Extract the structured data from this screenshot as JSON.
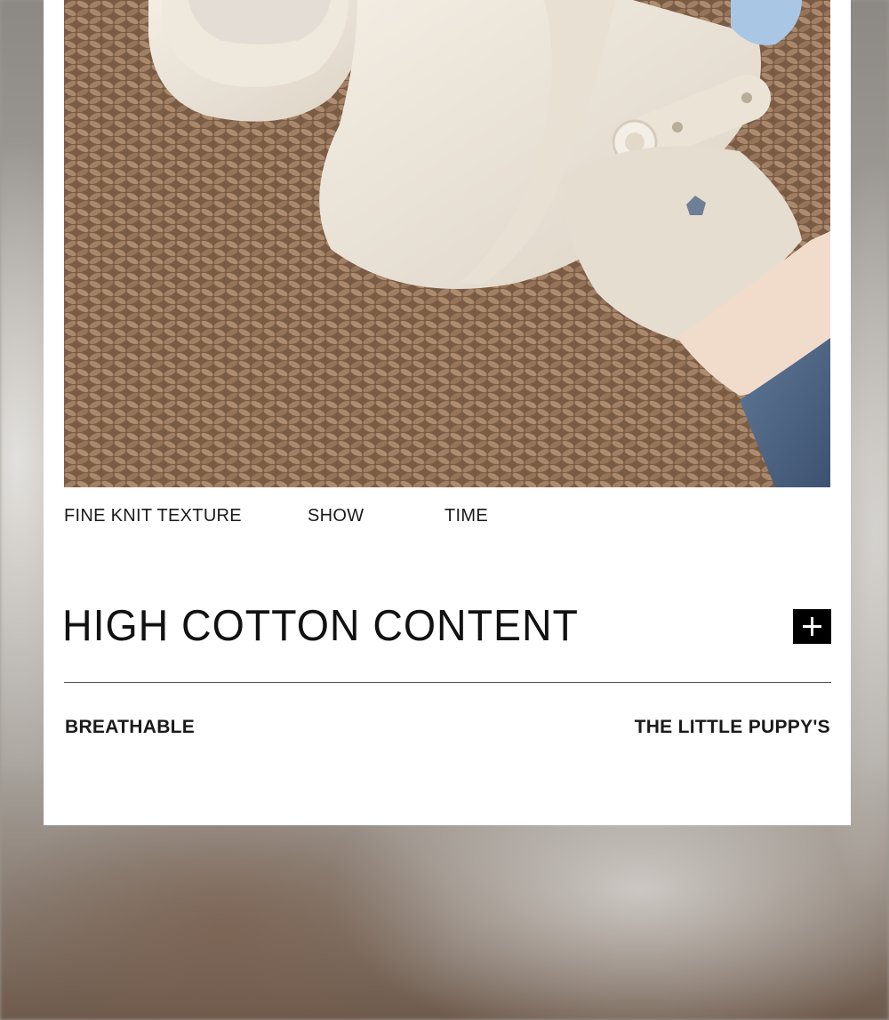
{
  "photo": {
    "icon": "product-photo-feet-clogs-socks"
  },
  "captions": [
    "FINE KNIT TEXTURE",
    "SHOW",
    "TIME"
  ],
  "headline": "HIGH COTTON CONTENT",
  "expand_button": {
    "icon": "plus-icon"
  },
  "features": {
    "left": "BREATHABLE",
    "right": "THE LITTLE PUPPY'S"
  },
  "colors": {
    "card": "#ffffff",
    "text": "#111111",
    "button": "#000000",
    "rug": "#8a6a52"
  }
}
